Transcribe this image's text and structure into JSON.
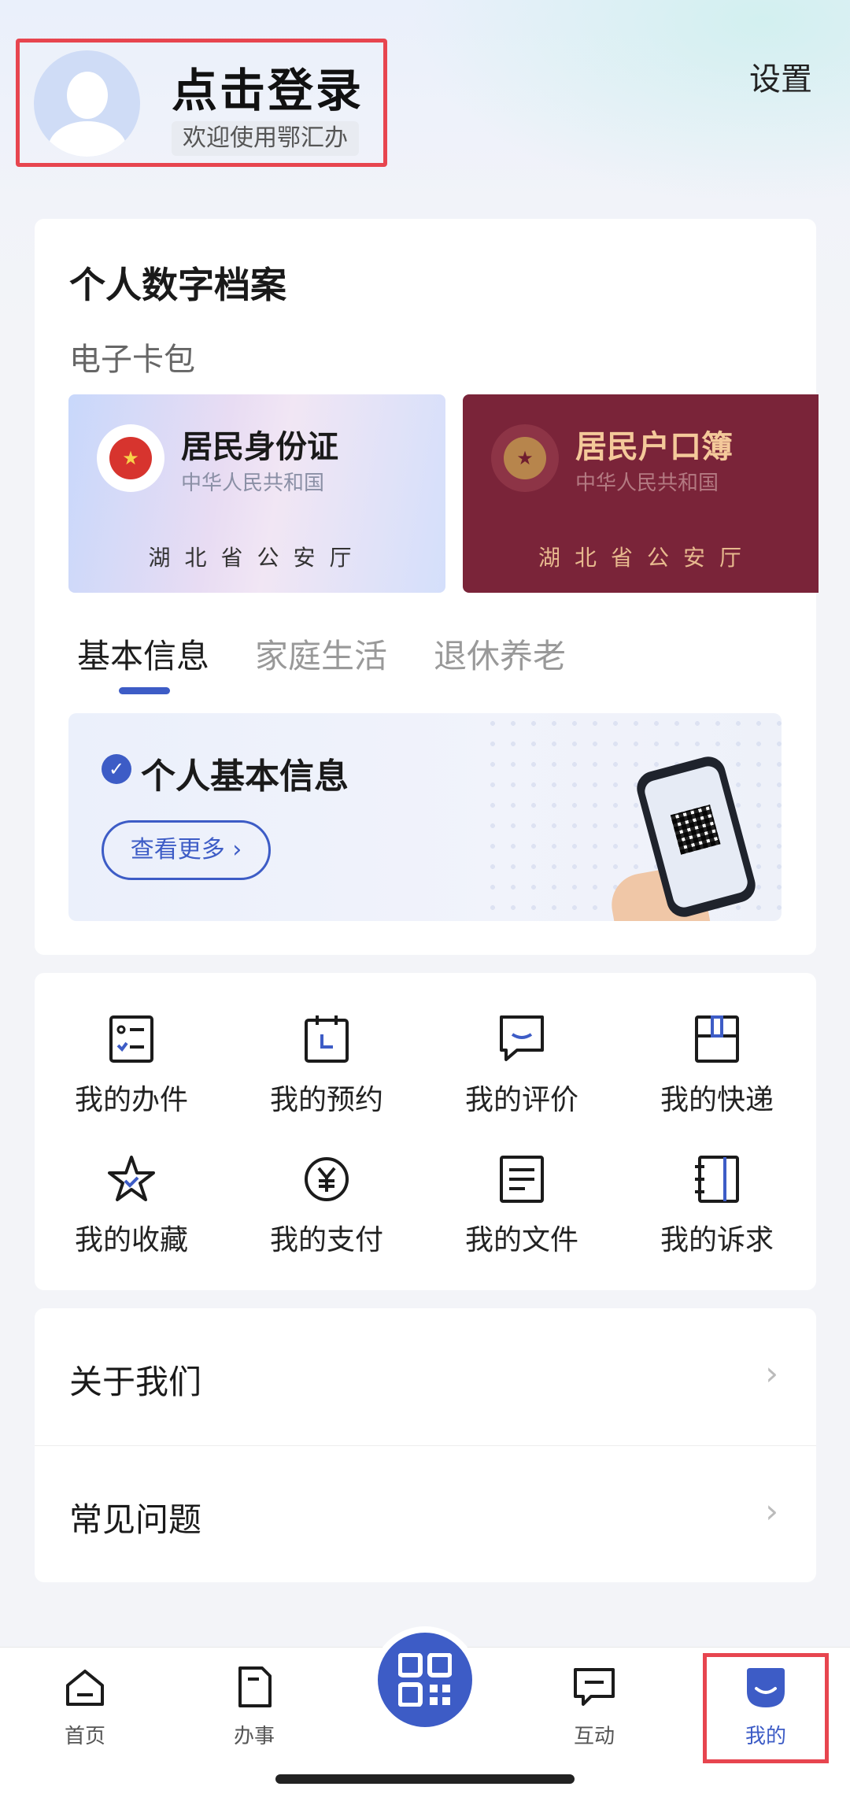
{
  "header": {
    "login_title": "点击登录",
    "welcome_text": "欢迎使用鄂汇办",
    "settings_label": "设置"
  },
  "profile": {
    "section_title": "个人数字档案",
    "wallet_title": "电子卡包",
    "cards": [
      {
        "name": "居民身份证",
        "country": "中华人民共和国",
        "issuer": "湖北省公安厅"
      },
      {
        "name": "居民户口簿",
        "country": "中华人民共和国",
        "issuer": "湖北省公安厅"
      }
    ],
    "tabs": [
      "基本信息",
      "家庭生活",
      "退休养老"
    ],
    "active_tab": "基本信息",
    "info_banner": {
      "title": "个人基本信息",
      "more_button": "查看更多 ›"
    }
  },
  "services": [
    {
      "label": "我的办件",
      "icon": "checklist-icon"
    },
    {
      "label": "我的预约",
      "icon": "calendar-icon"
    },
    {
      "label": "我的评价",
      "icon": "comment-icon"
    },
    {
      "label": "我的快递",
      "icon": "package-icon"
    },
    {
      "label": "我的收藏",
      "icon": "star-icon"
    },
    {
      "label": "我的支付",
      "icon": "yuan-icon"
    },
    {
      "label": "我的文件",
      "icon": "document-icon"
    },
    {
      "label": "我的诉求",
      "icon": "notebook-icon"
    }
  ],
  "list": [
    {
      "label": "关于我们"
    },
    {
      "label": "常见问题"
    }
  ],
  "tabbar": [
    {
      "label": "首页",
      "icon": "home-icon"
    },
    {
      "label": "办事",
      "icon": "file-icon"
    },
    {
      "label": "",
      "icon": "qr-scan-icon"
    },
    {
      "label": "互动",
      "icon": "message-icon"
    },
    {
      "label": "我的",
      "icon": "face-icon"
    }
  ],
  "colors": {
    "accent": "#3d5cc6",
    "highlight_border": "#e7454f",
    "hukou_card": "#7a2439",
    "page_bg": "#f3f4f8"
  }
}
